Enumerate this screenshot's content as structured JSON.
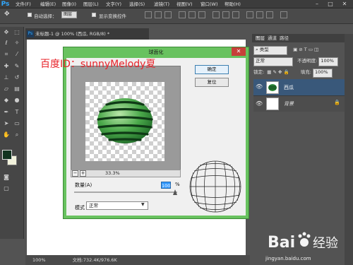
{
  "app": {
    "logo": "Ps",
    "accent": "#31a8ff"
  },
  "menu": [
    "文件(F)",
    "编辑(E)",
    "图像(I)",
    "图层(L)",
    "文字(Y)",
    "选择(S)",
    "滤镜(T)",
    "视图(V)",
    "窗口(W)",
    "帮助(H)"
  ],
  "window_controls": {
    "minimize": "–",
    "maximize": "□",
    "close": "✕"
  },
  "options": {
    "auto_select_label": "自动选择：",
    "auto_select_value": "图层",
    "show_transform_label": "显示变换控件"
  },
  "tools": [
    "move-tool",
    "marquee-tool",
    "lasso-tool",
    "magic-wand-tool",
    "crop-tool",
    "eyedropper-tool",
    "healing-brush-tool",
    "brush-tool",
    "clone-stamp-tool",
    "history-brush-tool",
    "eraser-tool",
    "gradient-tool",
    "blur-tool",
    "dodge-tool",
    "pen-tool",
    "type-tool",
    "path-select-tool",
    "shape-tool",
    "hand-tool",
    "zoom-tool"
  ],
  "colors": {
    "foreground": "#11331f",
    "background": "#f2f2dc",
    "dialog_frame": "#68c25f",
    "watermark": "#e8232a"
  },
  "document": {
    "tab_title": "未标题-1 @ 100% (西瓜, RGB/8) *"
  },
  "status": {
    "zoom": "100%",
    "doc_info": "文档:732.4K/976.6K"
  },
  "panels": {
    "tabs": [
      "图层",
      "通道",
      "路径"
    ],
    "filter_kind": "类型",
    "blend_mode": "正常",
    "opacity_label": "不透明度:",
    "opacity_value": "100%",
    "lock_label": "锁定:",
    "fill_label": "填充:",
    "fill_value": "100%",
    "layers": [
      {
        "name": "西瓜",
        "selected": true
      },
      {
        "name": "背景",
        "locked": true
      }
    ]
  },
  "dialog": {
    "title": "球面化",
    "ok_label": "确定",
    "reset_label": "复位",
    "zoom_value": "33.3%",
    "zoom_minus": "−",
    "zoom_plus": "+",
    "amount_label": "数量(A)",
    "amount_value": "100",
    "amount_unit": "%",
    "amount_fraction": 1.0,
    "mode_label": "模式",
    "mode_value": "正常"
  },
  "watermark": {
    "top_text": "百度ID：sunnyMelody夏",
    "logo_text": "Bai 经验",
    "url": "jingyan.baidu.com"
  }
}
